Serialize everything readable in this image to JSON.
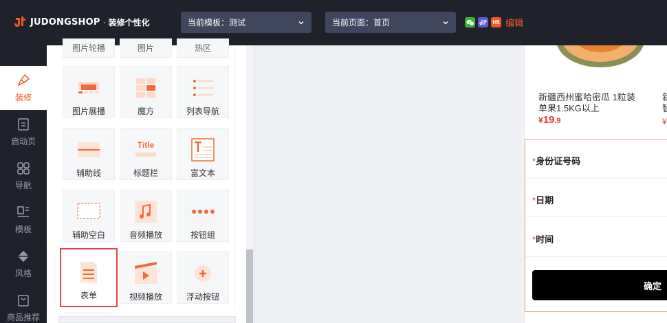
{
  "brand": {
    "name": "JUDONGSHOP",
    "separator": "·",
    "subtitle": "装修个性化"
  },
  "header": {
    "template_select": "当前模板：测试",
    "page_select": "当前页面：首页",
    "share_icons": [
      "wechat-icon",
      "mini-program-icon",
      "h5-icon"
    ],
    "h5_label": "H5",
    "edit_label": "编辑"
  },
  "leftnav": {
    "items": [
      {
        "label": "装修",
        "icon": "brush-icon",
        "active": true
      },
      {
        "label": "启动页",
        "icon": "startup-page-icon",
        "active": false
      },
      {
        "label": "导航",
        "icon": "grid-nav-icon",
        "active": false
      },
      {
        "label": "模板",
        "icon": "template-icon",
        "active": false
      },
      {
        "label": "风格",
        "icon": "paint-bucket-icon",
        "active": false
      },
      {
        "label": "商品推荐",
        "icon": "bag-icon",
        "active": false
      }
    ]
  },
  "components": {
    "row0": [
      "图片轮播",
      "图片",
      "热区"
    ],
    "tiles": [
      {
        "label": "图片展播",
        "icon": "image-showcase-icon"
      },
      {
        "label": "魔方",
        "icon": "magic-cube-icon"
      },
      {
        "label": "列表导航",
        "icon": "list-nav-icon"
      },
      {
        "label": "辅助线",
        "icon": "divider-line-icon"
      },
      {
        "label": "标题栏",
        "icon": "title-bar-icon",
        "icon_text": "Title"
      },
      {
        "label": "富文本",
        "icon": "rich-text-icon"
      },
      {
        "label": "辅助空白",
        "icon": "blank-space-icon"
      },
      {
        "label": "音频播放",
        "icon": "audio-icon"
      },
      {
        "label": "按钮组",
        "icon": "button-group-icon"
      },
      {
        "label": "表单",
        "icon": "form-icon",
        "selected": true
      },
      {
        "label": "视频播放",
        "icon": "video-icon"
      },
      {
        "label": "浮动按钮",
        "icon": "float-button-icon"
      }
    ]
  },
  "preview": {
    "product": {
      "title": "新疆西州蜜哈密瓜 1粒装单果1.5KG以上",
      "price_currency": "¥",
      "price_int": "19",
      "price_dec": ".9"
    },
    "product2": {
      "title_line1": "新",
      "title_line2": "智",
      "price": "¥"
    },
    "form": {
      "required_mark": "*",
      "fields": [
        "身份证号码",
        "日期",
        "时间"
      ],
      "submit_label": "确定"
    }
  },
  "colors": {
    "accent": "#f05a2a",
    "topbar": "#20222b",
    "select_bg": "#40465d",
    "price": "#e4393c"
  }
}
